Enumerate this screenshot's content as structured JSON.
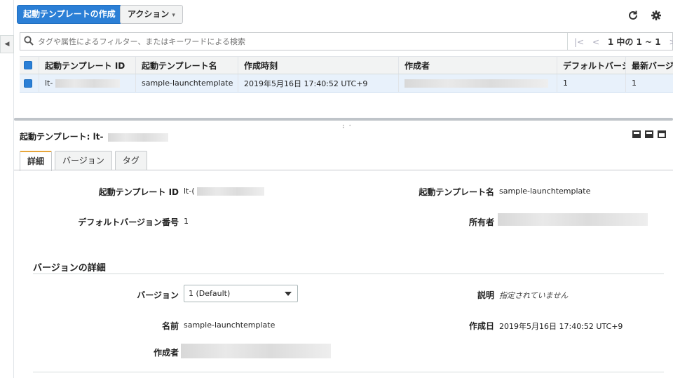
{
  "toolbar": {
    "create_label": "起動テンプレートの作成",
    "actions_label": "アクション",
    "actions_caret": "▾",
    "refresh_icon": "refresh-icon",
    "settings_icon": "gear-icon"
  },
  "search": {
    "placeholder": "タグや属性によるフィルター、またはキーワードによる検索"
  },
  "pager": {
    "first": "|<",
    "prev": "<",
    "text": "1 中の 1 ~ 1",
    "next": ">",
    "last": ">|"
  },
  "table": {
    "headers": [
      "起動テンプレート ID",
      "起動テンプレート名",
      "作成時刻",
      "作成者",
      "デフォルトバーシ",
      "最新バージョ"
    ],
    "rows": [
      {
        "id_prefix": "lt-",
        "name": "sample-launchtemplate",
        "created": "2019年5月16日 17:40:52 UTC+9",
        "default_version": "1",
        "latest_version": "1"
      }
    ]
  },
  "detail": {
    "title_prefix": "起動テンプレート: lt-",
    "tabs": [
      "詳細",
      "バージョン",
      "タグ"
    ],
    "fields": {
      "id_label": "起動テンプレート ID",
      "id_value_prefix": "lt-(",
      "name_label": "起動テンプレート名",
      "name_value": "sample-launchtemplate",
      "default_version_label": "デフォルトバージョン番号",
      "default_version_value": "1",
      "owner_label": "所有者"
    },
    "version_section": {
      "title": "バージョンの詳細",
      "version_label": "バージョン",
      "version_selected": "1 (Default)",
      "description_label": "説明",
      "description_value": "指定されていません",
      "name_label": "名前",
      "name_value": "sample-launchtemplate",
      "created_label": "作成日",
      "created_value": "2019年5月16日 17:40:52 UTC+9",
      "creator_label": "作成者"
    }
  },
  "colors": {
    "primary": "#2b7fd6",
    "selected_row": "#e8f1fb",
    "active_tab_accent": "#e7a63b"
  }
}
